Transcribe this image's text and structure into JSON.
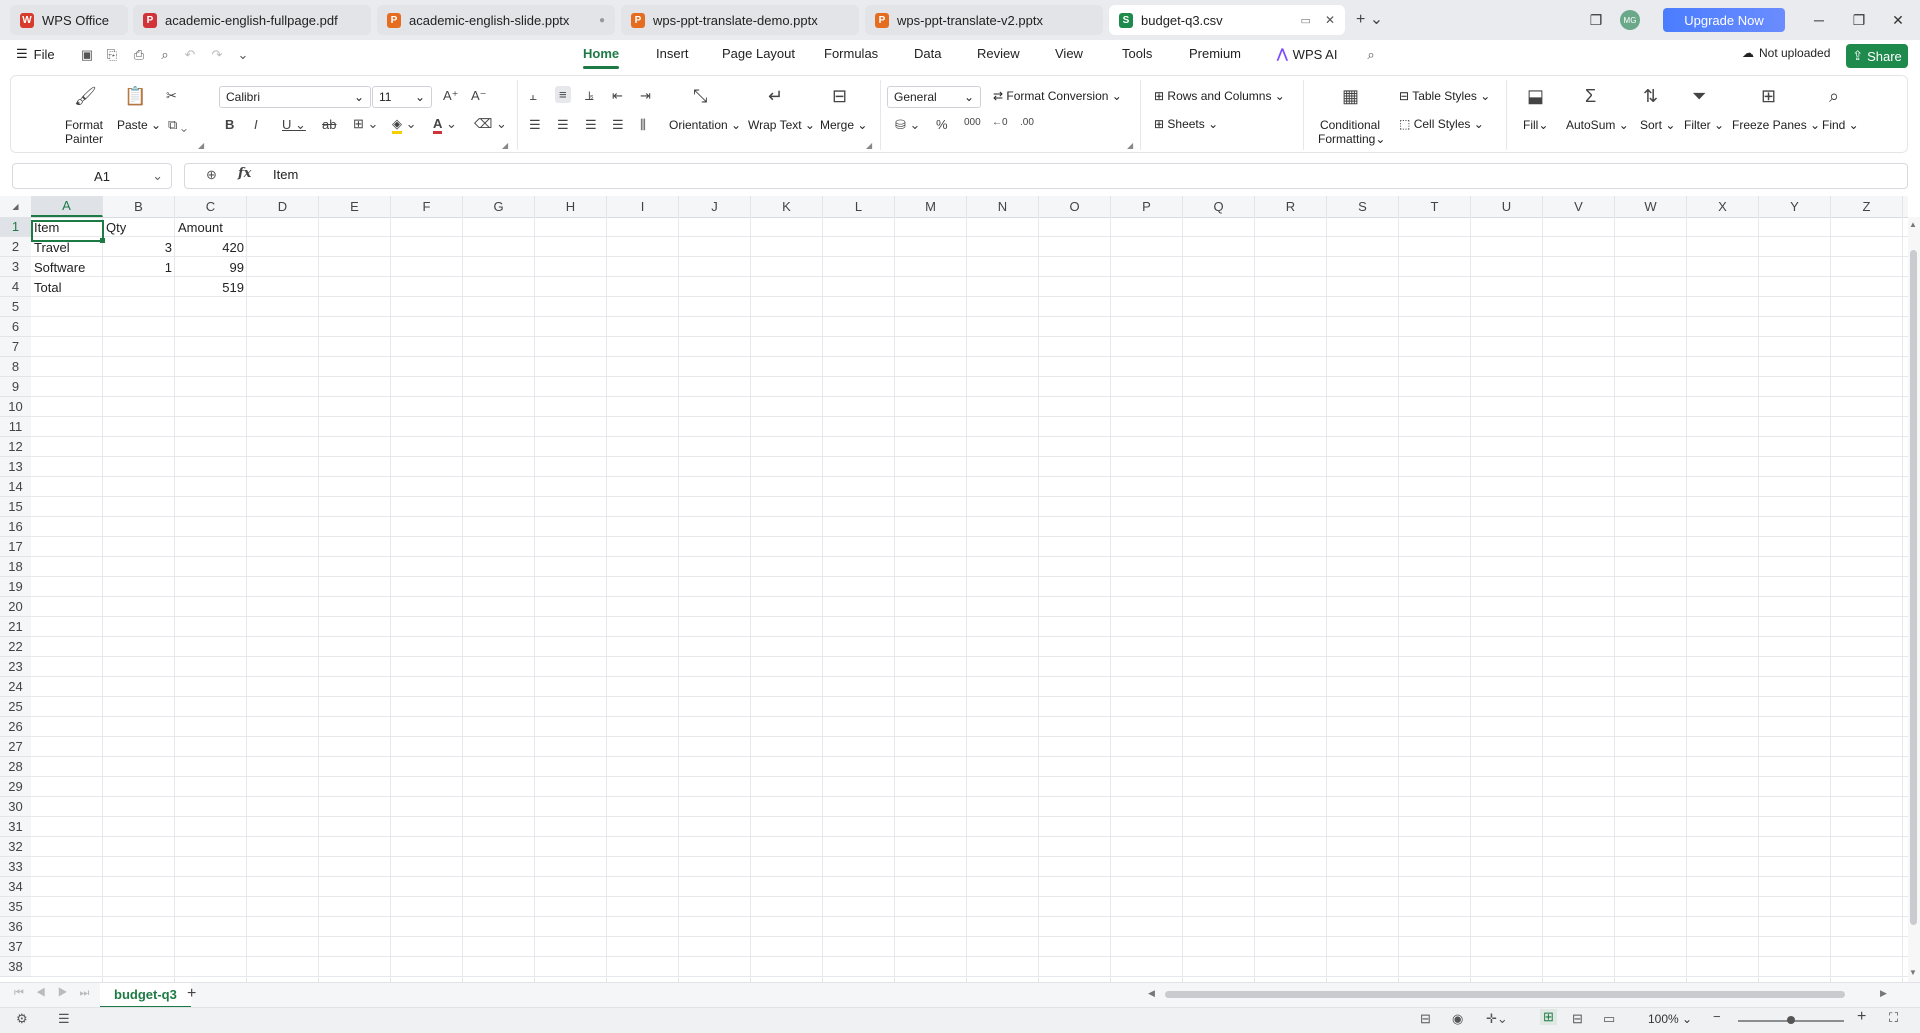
{
  "window": {
    "tabs": [
      {
        "label": "WPS Office",
        "icon": "wps-logo-icon",
        "color": "#d83b2b",
        "glyph": "W"
      },
      {
        "label": "academic-english-fullpage.pdf",
        "icon": "pdf-file-icon",
        "color": "#d13438",
        "glyph": "P"
      },
      {
        "label": "academic-english-slide.pptx",
        "icon": "pptx-file-icon",
        "color": "#e66c1f",
        "glyph": "P"
      },
      {
        "label": "wps-ppt-translate-demo.pptx",
        "icon": "pptx-file-icon",
        "color": "#e66c1f",
        "glyph": "P"
      },
      {
        "label": "wps-ppt-translate-v2.pptx",
        "icon": "pptx-file-icon",
        "color": "#e66c1f",
        "glyph": "P"
      },
      {
        "label": "budget-q3.csv",
        "icon": "spreadsheet-file-icon",
        "color": "#1e8a4c",
        "glyph": "S"
      }
    ],
    "avatar_initials": "MG",
    "upgrade_label": "Upgrade Now"
  },
  "menu": {
    "file_label": "File",
    "tabs": [
      "Home",
      "Insert",
      "Page Layout",
      "Formulas",
      "Data",
      "Review",
      "View",
      "Tools",
      "Premium"
    ],
    "active_tab": "Home",
    "wps_ai_label": "WPS AI",
    "not_uploaded_label": "Not uploaded",
    "share_label": "Share"
  },
  "ribbon": {
    "format_painter_line1": "Format",
    "format_painter_line2": "Painter",
    "paste_label": "Paste",
    "font_name": "Calibri",
    "font_size": "11",
    "number_format": "General",
    "format_conversion": "Format Conversion",
    "orientation": "Orientation",
    "wrap_text": "Wrap Text",
    "merge": "Merge",
    "rows_and_columns": "Rows and Columns",
    "sheets": "Sheets",
    "conditional_line1": "Conditional",
    "conditional_line2": "Formatting",
    "table_styles": "Table Styles",
    "cell_styles": "Cell Styles",
    "fill": "Fill",
    "autosum": "AutoSum",
    "sort": "Sort",
    "filter": "Filter",
    "freeze_panes": "Freeze Panes",
    "find": "Find"
  },
  "formula_bar": {
    "name_box": "A1",
    "fx_label": "fx",
    "content": "Item"
  },
  "grid": {
    "columns": [
      "A",
      "B",
      "C",
      "D",
      "E",
      "F",
      "G",
      "H",
      "I",
      "J",
      "K",
      "L",
      "M",
      "N",
      "O",
      "P",
      "Q",
      "R",
      "S",
      "T",
      "U",
      "V",
      "W",
      "X",
      "Y",
      "Z"
    ],
    "row_count": 38,
    "rows": [
      {
        "a": "Item",
        "b": "Qty",
        "c": "Amount"
      },
      {
        "a": "Travel",
        "b": "3",
        "c": "420"
      },
      {
        "a": "Software",
        "b": "1",
        "c": "99"
      },
      {
        "a": "Total",
        "b": "",
        "c": "519"
      }
    ],
    "active_cell": "A1"
  },
  "sheets": {
    "tabs": [
      "budget-q3"
    ]
  },
  "status": {
    "zoom": "100%"
  },
  "colors": {
    "accent": "#1e7a45",
    "upgrade": "#4a7dff",
    "share": "#1e8a4c"
  }
}
